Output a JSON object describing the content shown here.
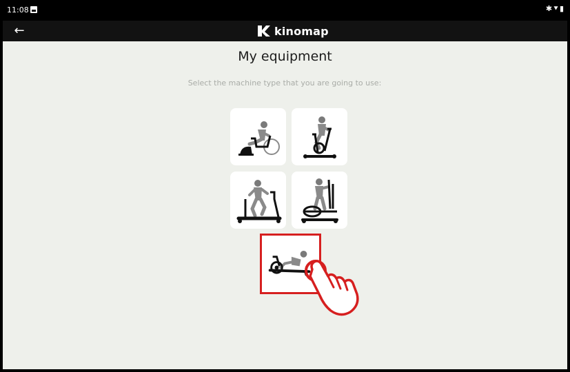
{
  "status_bar": {
    "time": "11:08",
    "right_icons": "bluetooth-icon, signal-icon"
  },
  "app_bar": {
    "back_label": "←",
    "brand_name": "kinomap"
  },
  "main": {
    "title": "My equipment",
    "subtitle": "Select the machine type that you are going to use:",
    "equipment": [
      {
        "name": "outdoor-bike-trainer",
        "icon": "bike-trainer-icon"
      },
      {
        "name": "exercise-bike",
        "icon": "exercise-bike-icon"
      },
      {
        "name": "treadmill",
        "icon": "treadmill-icon"
      },
      {
        "name": "elliptical",
        "icon": "elliptical-icon"
      },
      {
        "name": "rower",
        "icon": "rowing-machine-icon",
        "selected": true
      }
    ]
  },
  "colors": {
    "highlight": "#d61f1f",
    "background": "#eef0eb",
    "tile": "#ffffff",
    "appbar": "#121212"
  }
}
